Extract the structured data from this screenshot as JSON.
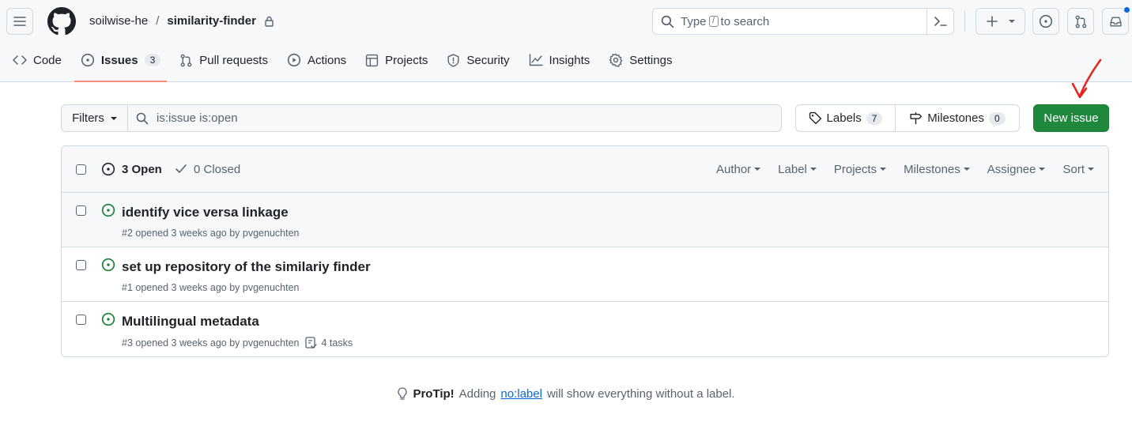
{
  "header": {
    "owner": "soilwise-he",
    "separator": "/",
    "repo": "similarity-finder",
    "search_prefix": "Type",
    "search_key": "/",
    "search_suffix": "to search"
  },
  "tabs": [
    {
      "label": "Code",
      "icon": "code-icon"
    },
    {
      "label": "Issues",
      "icon": "issue-opened-icon",
      "count": "3",
      "active": true
    },
    {
      "label": "Pull requests",
      "icon": "git-pull-request-icon"
    },
    {
      "label": "Actions",
      "icon": "play-icon"
    },
    {
      "label": "Projects",
      "icon": "table-icon"
    },
    {
      "label": "Security",
      "icon": "shield-icon"
    },
    {
      "label": "Insights",
      "icon": "graph-icon"
    },
    {
      "label": "Settings",
      "icon": "gear-icon"
    }
  ],
  "filterbar": {
    "filters_label": "Filters",
    "query": "is:issue is:open",
    "labels_label": "Labels",
    "labels_count": "7",
    "milestones_label": "Milestones",
    "milestones_count": "0",
    "new_issue_label": "New issue"
  },
  "list": {
    "open_label": "3 Open",
    "closed_label": "0 Closed",
    "sorts": [
      "Author",
      "Label",
      "Projects",
      "Milestones",
      "Assignee",
      "Sort"
    ],
    "issues": [
      {
        "title": "identify vice versa linkage",
        "meta": "#2 opened 3 weeks ago by pvgenuchten",
        "tasks": ""
      },
      {
        "title": "set up repository of the similariy finder",
        "meta": "#1 opened 3 weeks ago by pvgenuchten",
        "tasks": ""
      },
      {
        "title": "Multilingual metadata",
        "meta": "#3 opened 3 weeks ago by pvgenuchten",
        "tasks": "4 tasks"
      }
    ]
  },
  "protip": {
    "bold": "ProTip!",
    "before": "Adding",
    "link": "no:label",
    "after": "will show everything without a label."
  },
  "colors": {
    "accent_green": "#1f883d",
    "open_icon": "#1a7f37",
    "tab_underline": "#fd8c73",
    "link": "#0969da",
    "annotation_arrow": "#e5251d"
  }
}
